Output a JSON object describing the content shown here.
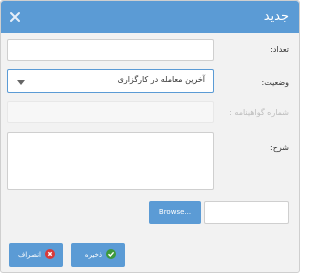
{
  "dialog": {
    "title": "جدید",
    "close_icon": "close-icon"
  },
  "form": {
    "count_label": "تعداد:",
    "count_value": "",
    "status_label": "وضعیت:",
    "status_selected": "آخرین معامله در کارگزاری",
    "certificate_label": "شماره گواهینامه :",
    "description_label": "شرح:",
    "description_value": "",
    "file_value": "",
    "browse_label": "Browse..."
  },
  "footer": {
    "save_label": "ذخیره",
    "cancel_label": "انصراف"
  },
  "colors": {
    "accent": "#5b9bd5",
    "save_icon": "#3c9a3c",
    "cancel_icon": "#d93a3a"
  }
}
